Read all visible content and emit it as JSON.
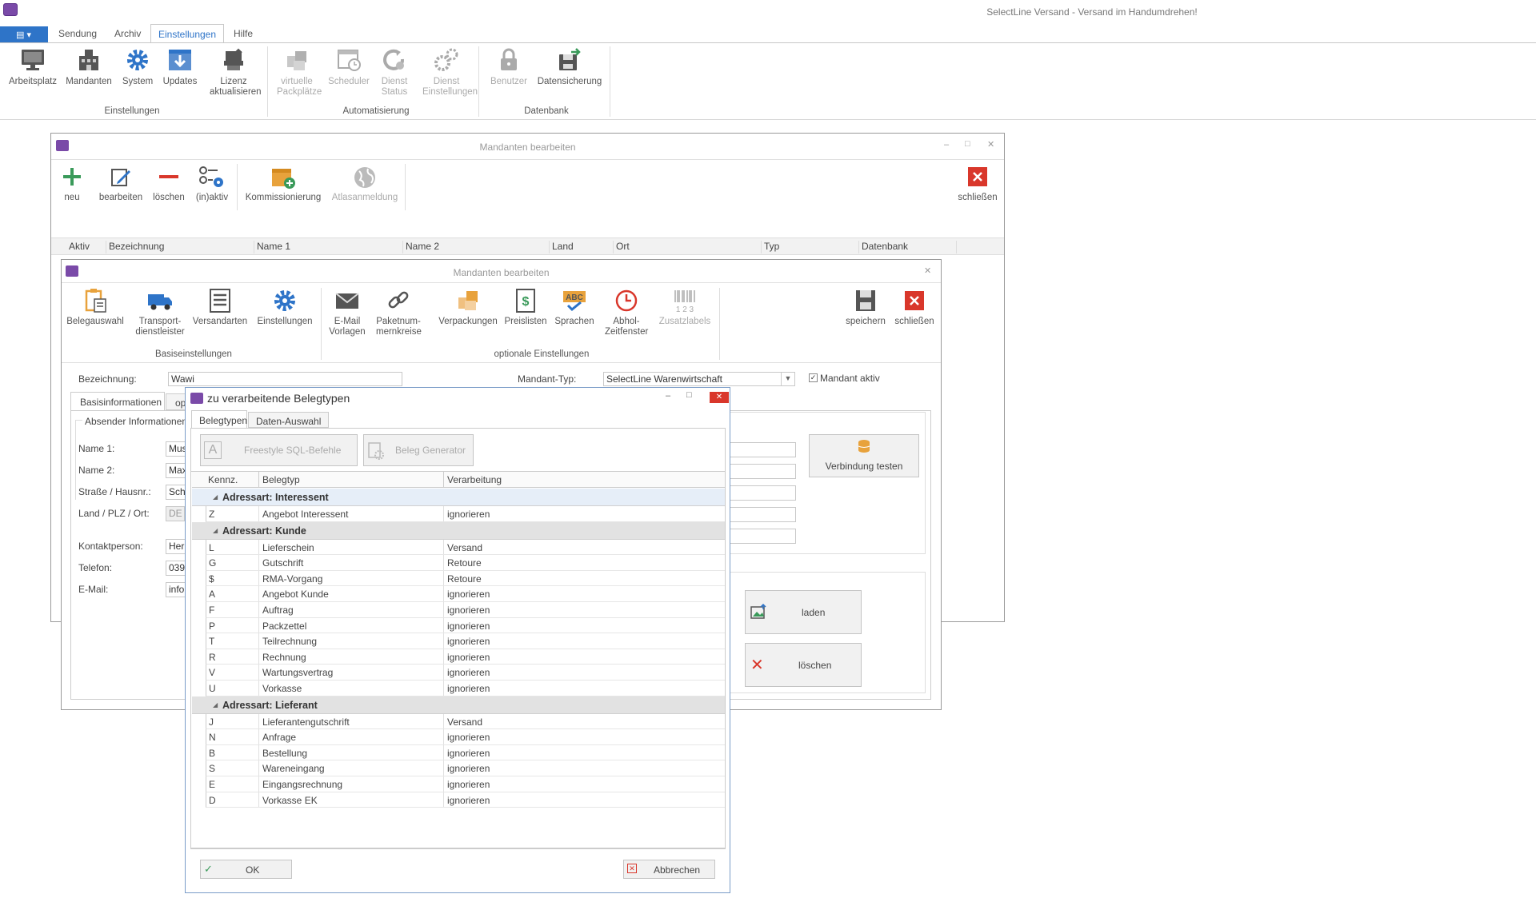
{
  "app": {
    "title": "SelectLine Versand - Versand im Handumdrehen!",
    "menu": [
      "Sendung",
      "Archiv",
      "Einstellungen",
      "Hilfe"
    ],
    "active_menu": "Einstellungen"
  },
  "ribbon": {
    "groups": [
      {
        "label": "Einstellungen",
        "items": [
          {
            "label": "Arbeitsplatz",
            "icon": "monitor-icon",
            "enabled": true
          },
          {
            "label": "Mandanten",
            "icon": "building-icon",
            "enabled": true
          },
          {
            "label": "System",
            "icon": "gear-icon",
            "enabled": true
          },
          {
            "label": "Updates",
            "icon": "download-icon",
            "enabled": true
          },
          {
            "label": "Lizenz aktualisieren",
            "icon": "license-icon",
            "enabled": true
          }
        ]
      },
      {
        "label": "Automatisierung",
        "items": [
          {
            "label": "virtuelle Packplätze",
            "icon": "packages-icon",
            "enabled": false
          },
          {
            "label": "Scheduler",
            "icon": "calendar-clock-icon",
            "enabled": false
          },
          {
            "label": "Dienst Status",
            "icon": "service-status-icon",
            "enabled": false
          },
          {
            "label": "Dienst Einstellungen",
            "icon": "service-gears-icon",
            "enabled": false
          }
        ]
      },
      {
        "label": "Datenbank",
        "items": [
          {
            "label": "Benutzer",
            "icon": "lock-icon",
            "enabled": false
          },
          {
            "label": "Datensicherung",
            "icon": "backup-icon",
            "enabled": true
          }
        ]
      }
    ]
  },
  "win1": {
    "title": "Mandanten bearbeiten",
    "toolbar": {
      "neu": "neu",
      "bearbeiten": "bearbeiten",
      "loeschen": "löschen",
      "inaktiv": "(in)aktiv",
      "kommissionierung": "Kommissionierung",
      "atlas": "Atlasanmeldung",
      "schliessen": "schließen"
    },
    "columns": [
      "Aktiv",
      "Bezeichnung",
      "Name 1",
      "Name 2",
      "Land",
      "Ort",
      "Typ",
      "Datenbank"
    ]
  },
  "win2": {
    "title": "Mandanten bearbeiten",
    "toolbar": {
      "basis": [
        "Belegauswahl",
        "Transport-dienstleister",
        "Versandarten",
        "Einstellungen"
      ],
      "optional": [
        "E-Mail Vorlagen",
        "Paketnum-mernkreise",
        "Verpackungen",
        "Preislisten",
        "Sprachen",
        "Abhol-Zeitfenster",
        "Zusatzlabels"
      ],
      "group_basis": "Basiseinstellungen",
      "group_optional": "optionale Einstellungen",
      "speichern": "speichern",
      "schliessen": "schließen"
    },
    "form": {
      "bezeichnung_label": "Bezeichnung:",
      "bezeichnung_value": "Wawi",
      "mandant_typ_label": "Mandant-Typ:",
      "mandant_typ_value": "SelectLine Warenwirtschaft",
      "mandant_aktiv_label": "Mandant aktiv",
      "tab_basis": "Basisinformationen",
      "tab_op": "op",
      "absender_label": "Absender Informationen",
      "name1_label": "Name 1:",
      "name1_value": "Mus",
      "name2_label": "Name 2:",
      "name2_value": "Max",
      "strasse_label": "Straße / Hausnr.:",
      "strasse_value": "Sch",
      "land_label": "Land / PLZ / Ort:",
      "land_value": "DE",
      "kontakt_label": "Kontaktperson:",
      "kontakt_value": "Herr",
      "telefon_label": "Telefon:",
      "telefon_value": "039",
      "email_label": "E-Mail:",
      "email_value": "info",
      "verbindung_testen": "Verbindung testen",
      "laden": "laden",
      "loeschen": "löschen"
    }
  },
  "dialog": {
    "title": "zu verarbeitende Belegtypen",
    "tabs": [
      "Belegtypen",
      "Daten-Auswahl"
    ],
    "btn_freestyle": "Freestyle SQL-Befehle",
    "btn_generator": "Beleg Generator",
    "columns": [
      "Kennz.",
      "Belegtyp",
      "Verarbeitung"
    ],
    "groups": [
      {
        "label": "Adressart: Interessent",
        "rows": [
          {
            "k": "Z",
            "typ": "Angebot Interessent",
            "v": "ignorieren"
          }
        ]
      },
      {
        "label": "Adressart: Kunde",
        "rows": [
          {
            "k": "L",
            "typ": "Lieferschein",
            "v": "Versand"
          },
          {
            "k": "G",
            "typ": "Gutschrift",
            "v": "Retoure"
          },
          {
            "k": "$",
            "typ": "RMA-Vorgang",
            "v": "Retoure"
          },
          {
            "k": "A",
            "typ": "Angebot Kunde",
            "v": "ignorieren"
          },
          {
            "k": "F",
            "typ": "Auftrag",
            "v": "ignorieren"
          },
          {
            "k": "P",
            "typ": "Packzettel",
            "v": "ignorieren"
          },
          {
            "k": "T",
            "typ": "Teilrechnung",
            "v": "ignorieren"
          },
          {
            "k": "R",
            "typ": "Rechnung",
            "v": "ignorieren"
          },
          {
            "k": "V",
            "typ": "Wartungsvertrag",
            "v": "ignorieren"
          },
          {
            "k": "U",
            "typ": "Vorkasse",
            "v": "ignorieren"
          }
        ]
      },
      {
        "label": "Adressart: Lieferant",
        "rows": [
          {
            "k": "J",
            "typ": "Lieferantengutschrift",
            "v": "Versand"
          },
          {
            "k": "N",
            "typ": "Anfrage",
            "v": "ignorieren"
          },
          {
            "k": "B",
            "typ": "Bestellung",
            "v": "ignorieren"
          },
          {
            "k": "S",
            "typ": "Wareneingang",
            "v": "ignorieren"
          },
          {
            "k": "E",
            "typ": "Eingangsrechnung",
            "v": "ignorieren"
          },
          {
            "k": "D",
            "typ": "Vorkasse EK",
            "v": "ignorieren"
          }
        ]
      }
    ],
    "ok": "OK",
    "abbrechen": "Abbrechen"
  },
  "colors": {
    "accent": "#2e74c8",
    "close_red": "#d9372b",
    "icon_gray": "#5a5a5a",
    "icon_blue": "#2e74c8",
    "icon_orange": "#e8a23c"
  }
}
